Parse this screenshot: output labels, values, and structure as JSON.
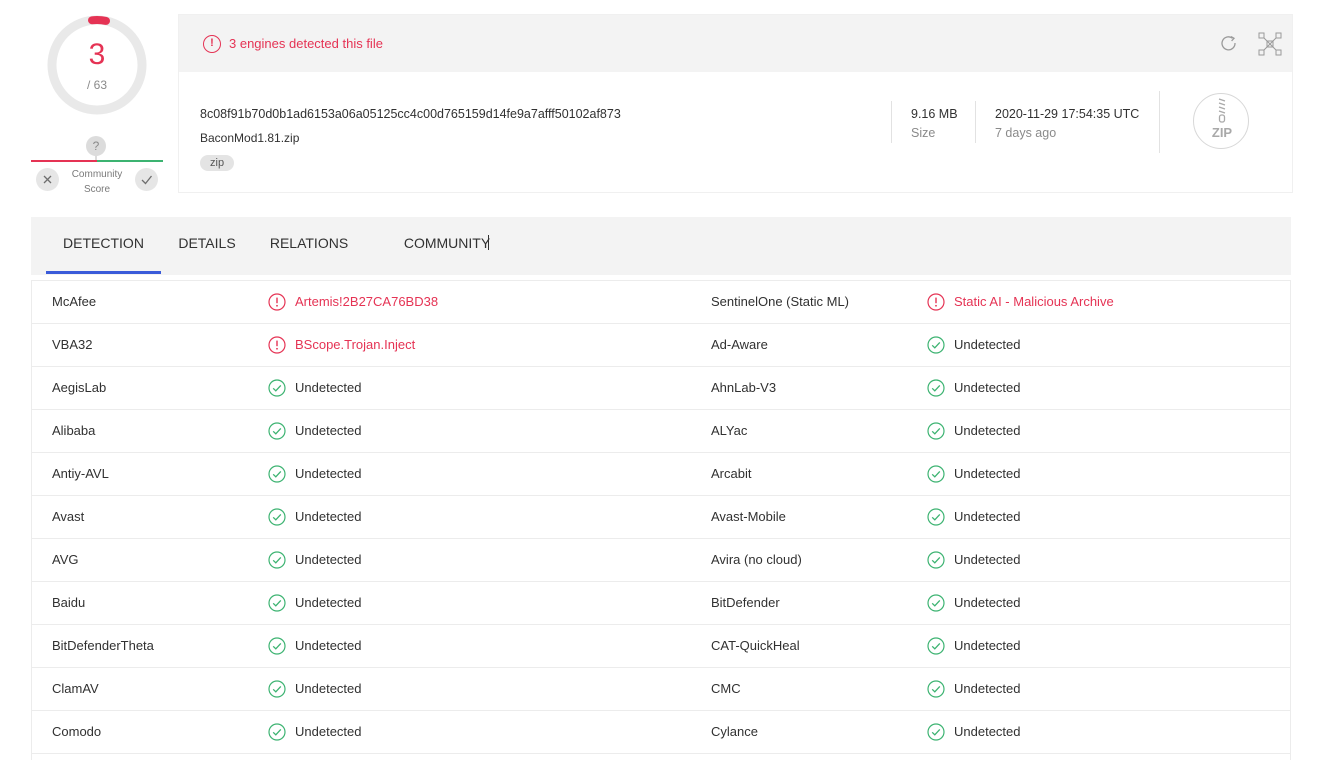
{
  "score": {
    "detections": "3",
    "total": "/ 63",
    "unknown_symbol": "?",
    "community_label": "Community Score",
    "vote_down_icon": "close-icon",
    "vote_up_icon": "check-icon"
  },
  "alert": {
    "icon": "alert-circle-icon",
    "text": "3 engines detected this file"
  },
  "file": {
    "hash": "8c08f91b70d0b1ad6153a06a05125cc4c00d765159d14fe9a7afff50102af873",
    "name": "BaconMod1.81.zip",
    "tag": "zip",
    "size_value": "9.16 MB",
    "size_label": "Size",
    "date_value": "2020-11-29 17:54:35 UTC",
    "date_relative": "7 days ago",
    "type_badge": "ZIP"
  },
  "tabs": [
    {
      "label": "DETECTION"
    },
    {
      "label": "DETAILS"
    },
    {
      "label": "RELATIONS"
    },
    {
      "label": "COMMUNITY"
    }
  ],
  "colors": {
    "malicious": "#e53354",
    "clean": "#3cb371",
    "accent": "#3a5bd9"
  },
  "results": [
    {
      "left_engine": "McAfee",
      "left_result": "Artemis!2B27CA76BD38",
      "left_status": "malicious",
      "right_engine": "SentinelOne (Static ML)",
      "right_result": "Static AI - Malicious Archive",
      "right_status": "malicious"
    },
    {
      "left_engine": "VBA32",
      "left_result": "BScope.Trojan.Inject",
      "left_status": "malicious",
      "right_engine": "Ad-Aware",
      "right_result": "Undetected",
      "right_status": "clean"
    },
    {
      "left_engine": "AegisLab",
      "left_result": "Undetected",
      "left_status": "clean",
      "right_engine": "AhnLab-V3",
      "right_result": "Undetected",
      "right_status": "clean"
    },
    {
      "left_engine": "Alibaba",
      "left_result": "Undetected",
      "left_status": "clean",
      "right_engine": "ALYac",
      "right_result": "Undetected",
      "right_status": "clean"
    },
    {
      "left_engine": "Antiy-AVL",
      "left_result": "Undetected",
      "left_status": "clean",
      "right_engine": "Arcabit",
      "right_result": "Undetected",
      "right_status": "clean"
    },
    {
      "left_engine": "Avast",
      "left_result": "Undetected",
      "left_status": "clean",
      "right_engine": "Avast-Mobile",
      "right_result": "Undetected",
      "right_status": "clean"
    },
    {
      "left_engine": "AVG",
      "left_result": "Undetected",
      "left_status": "clean",
      "right_engine": "Avira (no cloud)",
      "right_result": "Undetected",
      "right_status": "clean"
    },
    {
      "left_engine": "Baidu",
      "left_result": "Undetected",
      "left_status": "clean",
      "right_engine": "BitDefender",
      "right_result": "Undetected",
      "right_status": "clean"
    },
    {
      "left_engine": "BitDefenderTheta",
      "left_result": "Undetected",
      "left_status": "clean",
      "right_engine": "CAT-QuickHeal",
      "right_result": "Undetected",
      "right_status": "clean"
    },
    {
      "left_engine": "ClamAV",
      "left_result": "Undetected",
      "left_status": "clean",
      "right_engine": "CMC",
      "right_result": "Undetected",
      "right_status": "clean"
    },
    {
      "left_engine": "Comodo",
      "left_result": "Undetected",
      "left_status": "clean",
      "right_engine": "Cylance",
      "right_result": "Undetected",
      "right_status": "clean"
    }
  ]
}
